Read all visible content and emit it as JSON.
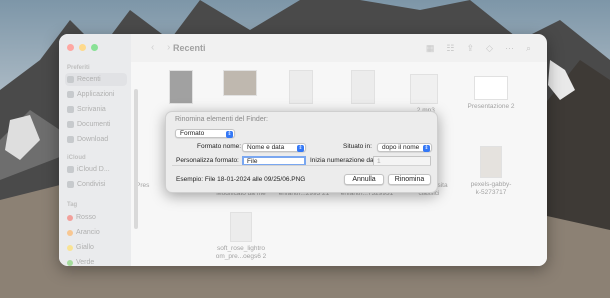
{
  "finder": {
    "title": "Recenti",
    "sidebar": {
      "favorites_title": "Preferiti",
      "favorites": [
        "Recenti",
        "Applicazioni",
        "Scrivania",
        "Documenti",
        "Download"
      ],
      "icloud_title": "iCloud",
      "icloud": [
        "iCloud D...",
        "Condivisi"
      ],
      "tags_title": "Tag",
      "tags": [
        {
          "label": "Rosso",
          "color": "#e8534a"
        },
        {
          "label": "Arancio",
          "color": "#f29a3a"
        },
        {
          "label": "Giallo",
          "color": "#f5cd3d"
        },
        {
          "label": "Verde",
          "color": "#5cc04e"
        }
      ]
    },
    "files": {
      "f3_name": "_2.mp3",
      "f4_name": "Presentazione 2",
      "f5_name": "Pres",
      "f6_name": "Modificato da me",
      "f7_name": "enfantn...2993 21",
      "f8_name": "enfantn...7329931",
      "f9_name1": "musica visita",
      "f9_name2": "classici",
      "f10_name1": "pexels-gabby-",
      "f10_name2": "k-5273717",
      "f11_name1": "soft_rose_lightro",
      "f11_name2": "om_pre...oegs6 2"
    }
  },
  "dialog": {
    "title": "Rinomina elementi del Finder:",
    "mode": "Formato",
    "format_label": "Formato nome:",
    "format_value": "Nome e data",
    "where_label": "Situato in:",
    "where_value": "dopo il nome",
    "custom_label": "Personalizza formato:",
    "custom_value": "File",
    "start_label": "Inizia numerazione da:",
    "start_value": "1",
    "example": "Esempio: File 18-01-2024 alle 09/25/06.PNG",
    "cancel": "Annulla",
    "rename": "Rinomina"
  },
  "colors": {
    "close": "#fe5f57",
    "minimize": "#febc2e",
    "zoom": "#28c840",
    "accent": "#3478f6"
  }
}
